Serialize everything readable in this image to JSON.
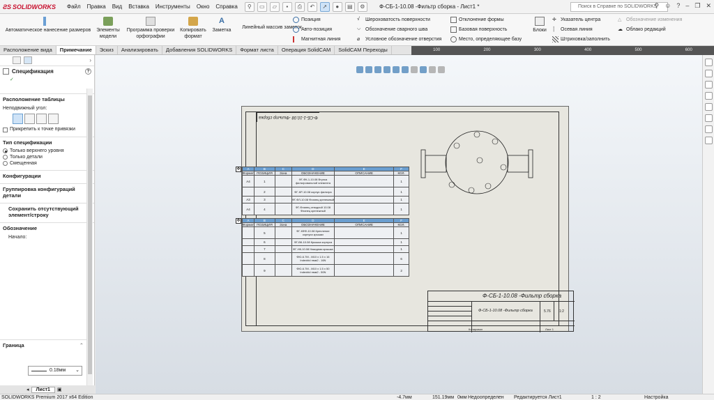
{
  "app": {
    "logo": "SOLIDWORKS",
    "menu": [
      "Файл",
      "Правка",
      "Вид",
      "Вставка",
      "Инструменты",
      "Окно",
      "Справка"
    ],
    "doc_title": "Ф-СБ-1-10.08 -Фильтр сборка - Лист1 *",
    "help_search": "Поиск в Справке по SOLIDWORKS",
    "accent": "#c8102e"
  },
  "ribbon": {
    "auto_dim": "Автоматическое нанесение размеров",
    "model_items": "Элементы модели",
    "spell_check": "Программа проверки орфографии",
    "copy_format": "Копировать формат",
    "note": "Заметка",
    "linear_pattern": "Линейный массив заметок",
    "balloon": "Позиция",
    "auto_balloon": "Авто-позиция",
    "magnetic_line": "Магнитная линия",
    "surface_finish": "Шероховатость поверхности",
    "weld_symbol": "Обозначение сварного шва",
    "hole_callout": "Условное обозначение отверстия",
    "geom_tol": "Отклонение формы",
    "datum_feature": "Базовая поверхность",
    "datum_target": "Место, определяющее базу",
    "blocks": "Блоки",
    "center_mark": "Указатель центра",
    "centerline": "Осевая линия",
    "hatch": "Штриховка/заполнить",
    "revision_symbol": "Обозначение изменения",
    "revision_cloud": "Облако редакций"
  },
  "command_tabs": [
    "Расположение вида",
    "Примечание",
    "Эскиз",
    "Анализировать",
    "Добавления SOLIDWORKS",
    "Формат листа",
    "Операция SolidCAM",
    "SolidCAM Переходы"
  ],
  "active_tab": "Примечание",
  "ruler": [
    "100",
    "200",
    "300",
    "400",
    "500",
    "600"
  ],
  "panel": {
    "title": "Спецификация",
    "table_position": "Расположение таблицы",
    "anchor_label": "Неподвижный угол:",
    "snap_label": "Прикрепить к точке привязки",
    "spec_type": "Тип спецификации",
    "spec_options": [
      "Только верхнего уровня",
      "Только детали",
      "Смещенная"
    ],
    "spec_selected": 0,
    "configurations": "Конфигурации",
    "config_grouping": "Группировка конфигураций детали",
    "keep_missing": "Сохранить отсутствующий элемент/строку",
    "designation": "Обозначение",
    "start_label": "Начало:",
    "border": "Граница",
    "border_value": "0.18мм"
  },
  "sheet_tab": "Лист1",
  "status": {
    "edition": "SOLIDWORKS Premium 2017 x64 Edition",
    "x": "-4.7мм",
    "y": "151.19мм",
    "z": "0мм",
    "state": "Недоопределен",
    "editing": "Редактируется Лист1",
    "scale": "1 : 2",
    "settings": "Настройка"
  },
  "drawing": {
    "stamp": "Ф-СБ-1-10.08 -Фильтр сборка",
    "title_block_name": "Ф-СБ-1-10.08 -Фильтр сборка",
    "title_block_sub": "Ф-СБ-1-10.08 -Фильтр сборка",
    "mass": "5.76",
    "scale": "1:2",
    "sheet_word": "Лист 1",
    "copied": "Копировал"
  },
  "bom": {
    "col_letters": [
      "A",
      "B",
      "C",
      "D",
      "E",
      "F"
    ],
    "headers": [
      "Формат",
      "ПОЗИЦИЯ",
      "Зона",
      "ОБОЗНАЧЕНИЕ",
      "ОПИСАНИЕ",
      "КОЛ."
    ],
    "rows1": [
      {
        "fmt": "А4",
        "pos": "1",
        "des": "ФГ-ФК-1-10.08 Втулка фильтровальной элемента",
        "qty": "1"
      },
      {
        "fmt": "",
        "pos": "2",
        "des": "ФГ-КР-10.08 корпус фильтра",
        "qty": "1"
      },
      {
        "fmt": "А3",
        "pos": "3",
        "des": "ФГ-ФЛ-10.08 Фланец крепежный",
        "qty": "1"
      },
      {
        "fmt": "А4",
        "pos": "4",
        "des": "ФГ-Фланец отводной 10.08 Фланец крепежный",
        "qty": "1"
      }
    ],
    "rows2": [
      {
        "fmt": "",
        "pos": "5",
        "des": "ФГ-КФФ-10.08 Крепление корпуса крышки",
        "qty": "1"
      },
      {
        "fmt": "",
        "pos": "6",
        "des": "ФГ-ВК-10.08 Крышка корпуса",
        "qty": "1"
      },
      {
        "fmt": "",
        "pos": "7",
        "des": "ФГ-НК-10.08 Накидная крышка",
        "qty": "1"
      },
      {
        "fmt": "",
        "pos": "8",
        "des": "ФЮ-6.7M - M10 x 1.5 x 16 Indexbid нмм2 - 16N",
        "qty": "6"
      },
      {
        "fmt": "",
        "pos": "9",
        "des": "ФЮ-6.7M - M10 x 1.5 x 50 Indexbid нмм2 - 50N",
        "qty": "2"
      }
    ]
  }
}
